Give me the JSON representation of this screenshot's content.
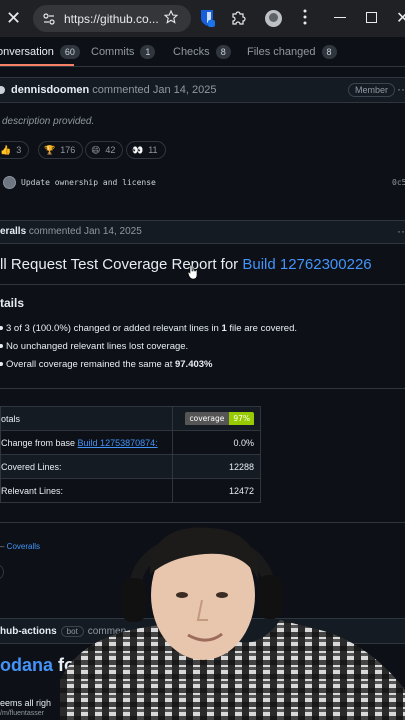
{
  "browser": {
    "url": "https://github.co..."
  },
  "tabs": [
    {
      "label": "onversation",
      "count": "60"
    },
    {
      "label": "Commits",
      "count": "1"
    },
    {
      "label": "Checks",
      "count": "8"
    },
    {
      "label": "Files changed",
      "count": "8"
    }
  ],
  "comment1": {
    "author": "dennisdoomen",
    "meta": "commented Jan 14, 2025",
    "role": "Member",
    "body": "description provided.",
    "reactions": [
      {
        "emoji": "👍",
        "count": "3"
      },
      {
        "emoji": "🏆",
        "count": "176"
      },
      {
        "emoji": "😄",
        "count": "42"
      },
      {
        "emoji": "👀",
        "count": "11"
      }
    ],
    "commit_message": "Update ownership and license",
    "commit_sha": "0c5"
  },
  "comment2": {
    "author": "eralls",
    "meta": "commented Jan 14, 2025",
    "title_text": "ll Request Test Coverage Report for ",
    "title_link": "Build 12762300226",
    "details_heading": "tails",
    "bullet1_pre": "3 of 3 (100.0%) changed or added relevant lines in ",
    "bullet1_bold": "1",
    "bullet1_post": " file are covered.",
    "bullet2": "No unchanged relevant lines lost coverage.",
    "bullet3_pre": "Overall coverage remained the same at ",
    "bullet3_bold": "97.403%",
    "totals_label": "otals",
    "badge_left": "coverage",
    "badge_right": "97%",
    "rows": [
      {
        "label": "Change from base ",
        "link": "Build 12753870874:",
        "value": "0.0%"
      },
      {
        "label": "Covered Lines:",
        "link": "",
        "value": "12288"
      },
      {
        "label": "Relevant Lines:",
        "link": "",
        "value": "12472"
      }
    ],
    "signature_dash": "– ",
    "signature_link": "Coveralls"
  },
  "comment3": {
    "author": "hub-actions",
    "bot": "bot",
    "meta": "commen",
    "heading_link": "odana",
    "heading_text": " fo",
    "body": "eems all righ",
    "path": "/m/fluentasser"
  },
  "colors": {
    "bg": "#0d1117",
    "link": "#4493f8",
    "accent_underline": "#f78166",
    "badge_green": "#97ca00"
  }
}
